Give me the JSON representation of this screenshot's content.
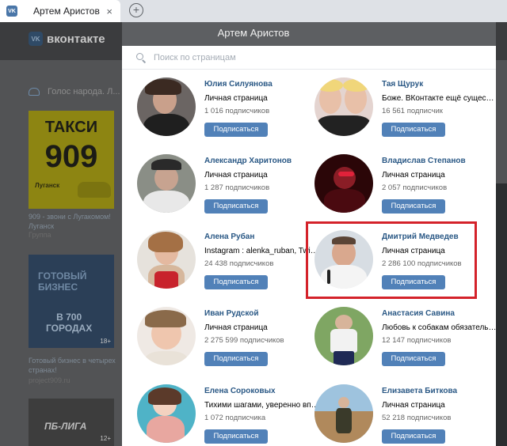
{
  "browser": {
    "tab_title": "Артем Аристов",
    "new_tab": "+",
    "close": "×"
  },
  "background_page": {
    "logo_text": "вконтакте",
    "logo_badge": "VK",
    "group_line": "Голос народа. Л...",
    "ads": [
      {
        "title_line1": "ТАКСИ",
        "title_line2": "909",
        "brand": "Луганск",
        "caption": "909 - звони с Лугакомом! Луганск",
        "sub": "Группа"
      },
      {
        "title_line1": "ГОТОВЫЙ\nБИЗНЕС",
        "title_line2": "В 700\nГОРОДАХ",
        "age": "18+",
        "caption": "Готовый бизнес в четырех странах!",
        "sub": "project909.ru"
      },
      {
        "title_line1": "ПБ-ЛИГА",
        "age": "12+"
      }
    ]
  },
  "modal": {
    "title": "Артем Аристов",
    "search_placeholder": "Поиск по страницам",
    "cards": [
      {
        "name": "Юлия Силуянова",
        "desc": "Личная страница",
        "subs": "1 016 подписчиков",
        "button": "Подписаться"
      },
      {
        "name": "Тая Щурук",
        "desc": "Боже. ВКонтакте ещё существует",
        "subs": "16 561 подписчик",
        "button": "Подписаться"
      },
      {
        "name": "Александр Харитонов",
        "desc": "Личная страница",
        "subs": "1 287 подписчиков",
        "button": "Подписаться"
      },
      {
        "name": "Владислав Степанов",
        "desc": "Личная страница",
        "subs": "2 057 подписчиков",
        "button": "Подписаться"
      },
      {
        "name": "Алена Рубан",
        "desc": "Instagram : alenka_ruban, Twitter",
        "subs": "24 438 подписчиков",
        "button": "Подписаться"
      },
      {
        "name": "Дмитрий Медведев",
        "desc": "Личная страница",
        "subs": "2 286 100 подписчиков",
        "button": "Подписаться",
        "highlighted": true
      },
      {
        "name": "Иван Рудской",
        "desc": "Личная страница",
        "subs": "2 275 599 подписчиков",
        "button": "Подписаться"
      },
      {
        "name": "Анастасия Савина",
        "desc": "Любовь к собакам обязательна",
        "subs": "12 147 подписчиков",
        "button": "Подписаться"
      },
      {
        "name": "Елена Сороковых",
        "desc": "Тихими шагами, уверенно вперёд",
        "subs": "1 072 подписчика",
        "button": "Подписаться"
      },
      {
        "name": "Елизавета Биткова",
        "desc": "Личная страница",
        "subs": "52 218 подписчиков",
        "button": "Подписаться"
      }
    ]
  },
  "colors": {
    "link": "#2a5885",
    "button": "#5181b8",
    "highlight_border": "#d4222a"
  }
}
